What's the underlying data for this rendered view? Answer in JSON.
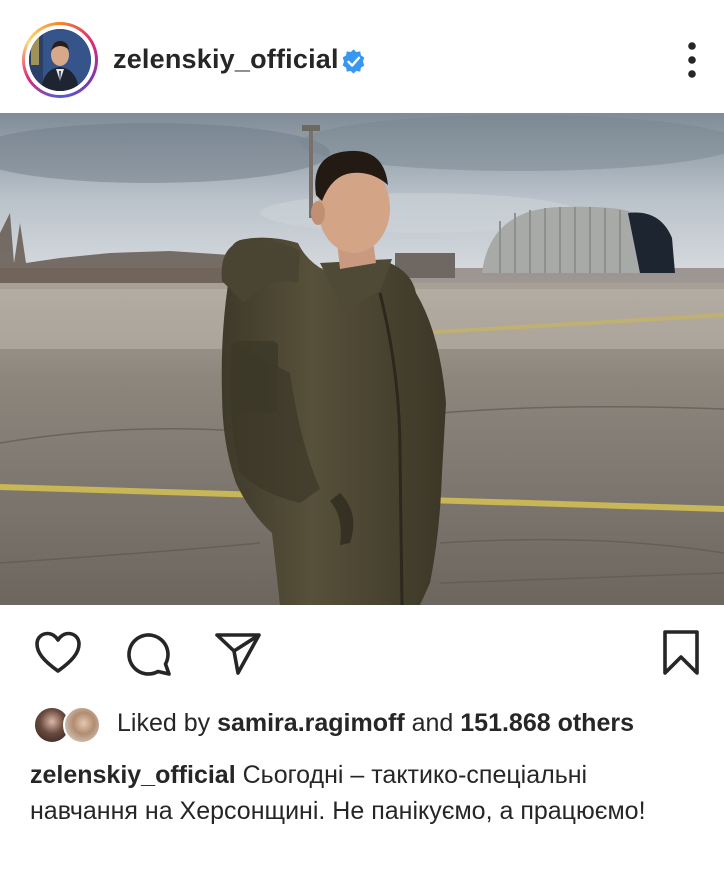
{
  "post": {
    "username": "zelenskiy_official",
    "verified_icon": "verified-badge-icon",
    "more_icon": "more-options-icon",
    "actions": {
      "like_icon": "heart-icon",
      "comment_icon": "comment-icon",
      "share_icon": "send-icon",
      "save_icon": "bookmark-icon"
    },
    "likes": {
      "prefix": "Liked by",
      "user": "samira.ragimoff",
      "and": "and",
      "count": "151.868 others"
    },
    "caption": {
      "username": "zelenskiy_official",
      "text": "Сьогодні – тактико-спеціальні навчання на Херсонщині. Не панікуємо, а працюємо!"
    }
  },
  "colors": {
    "verified": "#3897f0",
    "text": "#262626",
    "jacket": "#4f4a35"
  }
}
